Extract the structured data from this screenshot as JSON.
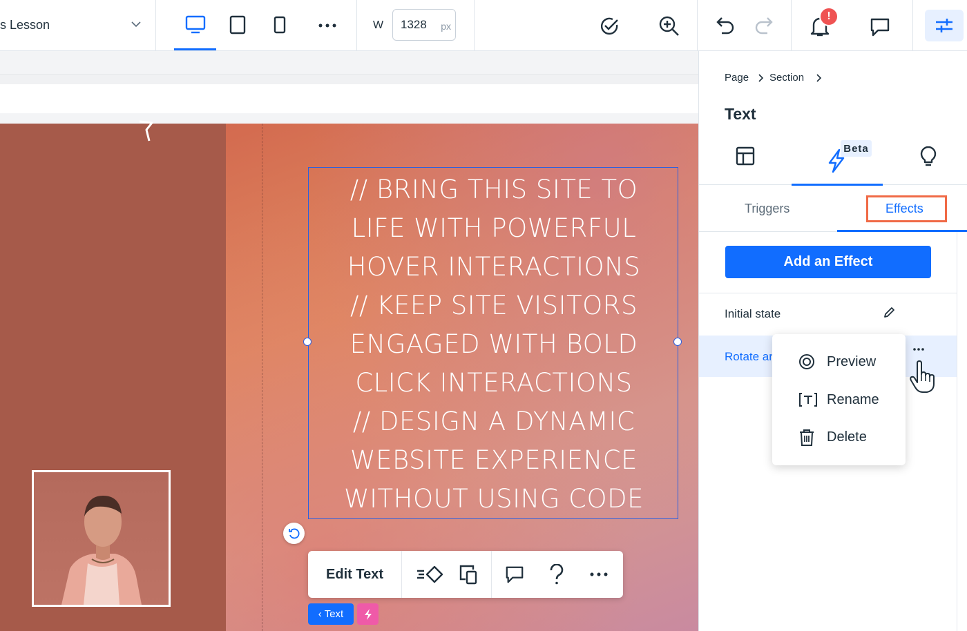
{
  "topbar": {
    "page_name": "s Lesson",
    "width_label": "W",
    "width_value": "1328",
    "width_unit": "px",
    "notification_count": "!"
  },
  "canvas": {
    "copy_lines": [
      "// BRING THIS SITE TO",
      "LIFE WITH POWERFUL",
      "HOVER INTERACTIONS",
      "// KEEP SITE VISITORS",
      "ENGAGED WITH BOLD",
      "CLICK INTERACTIONS",
      "// DESIGN A DYNAMIC",
      "WEBSITE EXPERIENCE",
      "WITHOUT USING CODE"
    ],
    "toolbar": {
      "edit_text_label": "Edit Text"
    },
    "breadcrumb_chip": "‹ Text"
  },
  "panel": {
    "breadcrumb": [
      "Page",
      "Section"
    ],
    "title": "Text",
    "beta_badge": "Beta",
    "subtabs": {
      "triggers": "Triggers",
      "effects": "Effects"
    },
    "add_effect_label": "Add an Effect",
    "initial_state_label": "Initial state",
    "effect_row_label": "Rotate ar",
    "context_menu": {
      "preview": "Preview",
      "rename": "Rename",
      "delete": "Delete"
    }
  },
  "colors": {
    "accent": "#116dff",
    "highlight": "#f06a46",
    "badge": "#ef5353",
    "left_column": "#a65a4a"
  }
}
